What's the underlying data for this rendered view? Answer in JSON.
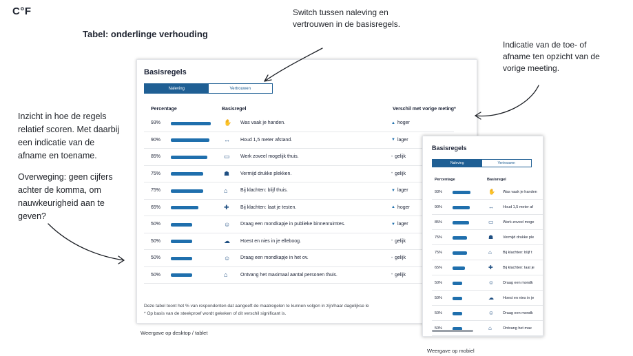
{
  "logo": "C°F",
  "page_title": "Tabel: onderlinge verhouding",
  "annotations": {
    "top": "Switch tussen naleving en vertrouwen in de basisregels.",
    "right": "Indicatie van de toe- of afname ten opzicht van de vorige meeting.",
    "left_1": "Inzicht in hoe de regels relatief scoren. Met daarbij een indicatie van de afname en toename.",
    "left_2": "Overweging: geen cijfers achter de komma, om nauwkeurigheid aan te geven?"
  },
  "desktop": {
    "title": "Basisregels",
    "tabs": [
      "Naleving",
      "Vertrouwen"
    ],
    "active_tab": 0,
    "headers": {
      "percentage": "Percentage",
      "rule": "Basisregel",
      "diff": "Verschil met vorige meting*"
    },
    "rows": [
      {
        "pct": "93%",
        "value": 93,
        "icon": "hand-wash-icon",
        "glyph": "✋",
        "rule": "Was vaak je handen.",
        "diff": "hoger",
        "trend": "up"
      },
      {
        "pct": "90%",
        "value": 90,
        "icon": "distance-icon",
        "glyph": "↔",
        "rule": "Houd 1,5 meter afstand.",
        "diff": "lager",
        "trend": "down"
      },
      {
        "pct": "85%",
        "value": 85,
        "icon": "laptop-icon",
        "glyph": "▭",
        "rule": "Werk zoveel mogelijk thuis.",
        "diff": "gelijk",
        "trend": "same"
      },
      {
        "pct": "75%",
        "value": 75,
        "icon": "crowd-icon",
        "glyph": "☗",
        "rule": "Vermijd drukke plekken.",
        "diff": "gelijk",
        "trend": "same"
      },
      {
        "pct": "75%",
        "value": 75,
        "icon": "home-icon",
        "glyph": "⌂",
        "rule": "Bij klachten: blijf thuis.",
        "diff": "lager",
        "trend": "down"
      },
      {
        "pct": "65%",
        "value": 65,
        "icon": "test-icon",
        "glyph": "✚",
        "rule": "Bij klachten: laat je testen.",
        "diff": "hoger",
        "trend": "up"
      },
      {
        "pct": "50%",
        "value": 50,
        "icon": "mask-icon",
        "glyph": "☺",
        "rule": "Draag een mondkapje in publieke binnenruimtes.",
        "diff": "lager",
        "trend": "down"
      },
      {
        "pct": "50%",
        "value": 50,
        "icon": "cough-icon",
        "glyph": "☁",
        "rule": "Hoest en nies in je elleboog.",
        "diff": "gelijk",
        "trend": "same"
      },
      {
        "pct": "50%",
        "value": 50,
        "icon": "mask-ov-icon",
        "glyph": "☺",
        "rule": "Draag een mondkapje in het ov.",
        "diff": "gelijk",
        "trend": "same"
      },
      {
        "pct": "50%",
        "value": 50,
        "icon": "house-guests-icon",
        "glyph": "⌂",
        "rule": "Ontvang het maximaal aantal personen thuis.",
        "diff": "gelijk",
        "trend": "same"
      }
    ],
    "footnote_1": "Deze tabel toont het % van respondenten dat aangeeft de maatregelen te kunnen volgen in zijn/haar dagelijkse le",
    "footnote_2": "* Op basis van de steekproef wordt gekeken of dit verschil significant is.",
    "caption": "Weergave op desktop / tablet"
  },
  "mobile": {
    "title": "Basisregels",
    "tabs": [
      "Naleving",
      "Vertrouwen"
    ],
    "headers": {
      "percentage": "Percentage",
      "rule": "Basisregel"
    },
    "rows": [
      {
        "pct": "93%",
        "value": 93,
        "glyph": "✋",
        "rule": "Was vaak je handen"
      },
      {
        "pct": "90%",
        "value": 90,
        "glyph": "↔",
        "rule": "Houd 1,5 meter af"
      },
      {
        "pct": "85%",
        "value": 85,
        "glyph": "▭",
        "rule": "Werk zoveel moge"
      },
      {
        "pct": "75%",
        "value": 75,
        "glyph": "☗",
        "rule": "Vermijd drukke ple"
      },
      {
        "pct": "75%",
        "value": 75,
        "glyph": "⌂",
        "rule": "Bij klachten: blijf t"
      },
      {
        "pct": "65%",
        "value": 65,
        "glyph": "✚",
        "rule": "Bij klachten: laat je"
      },
      {
        "pct": "50%",
        "value": 50,
        "glyph": "☺",
        "rule": "Draag een mondk"
      },
      {
        "pct": "50%",
        "value": 50,
        "glyph": "☁",
        "rule": "Hoest en nies in je"
      },
      {
        "pct": "50%",
        "value": 50,
        "glyph": "☺",
        "rule": "Draag een mondk"
      },
      {
        "pct": "50%",
        "value": 50,
        "glyph": "⌂",
        "rule": "Ontvang het max"
      }
    ],
    "caption": "Weergave op mobiel"
  },
  "colors": {
    "accent": "#1f6fad",
    "tab_active": "#1f5f94"
  }
}
